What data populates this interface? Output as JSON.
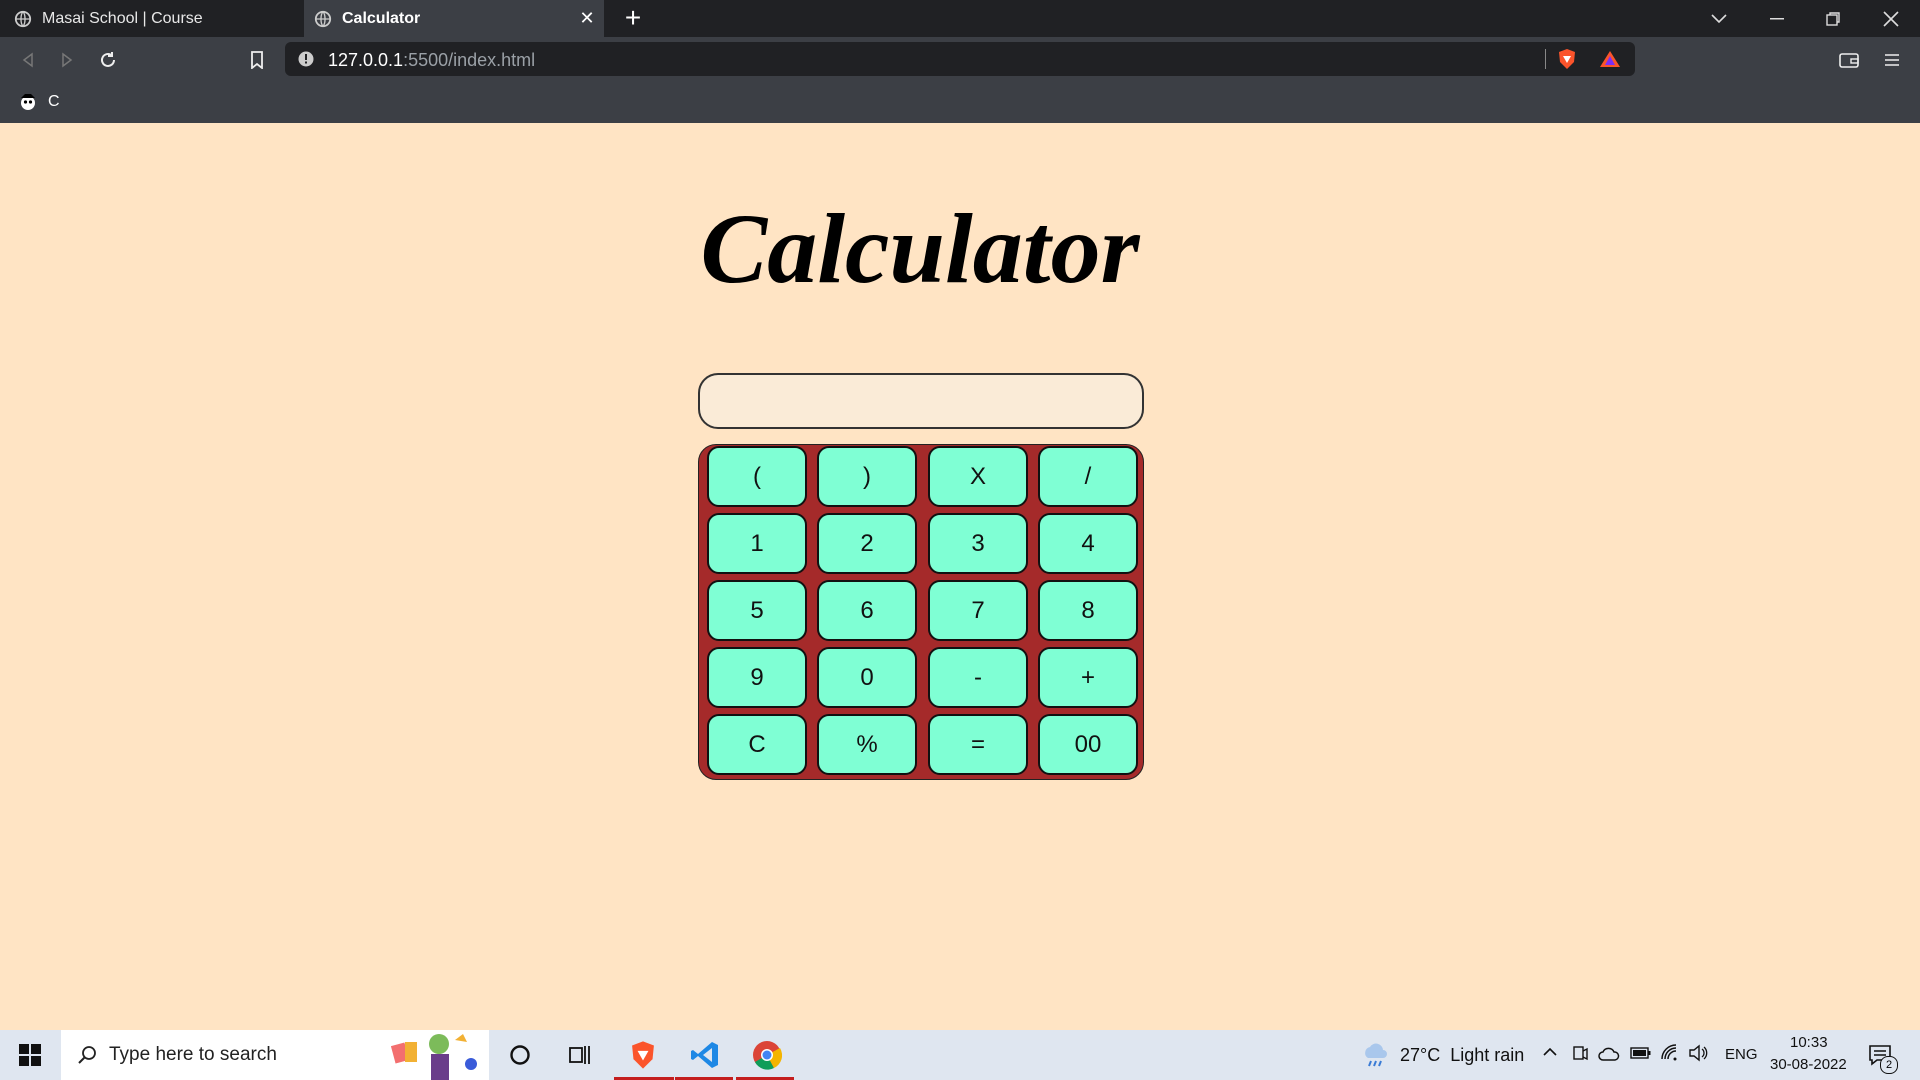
{
  "browser": {
    "tabs": [
      {
        "label": "Masai School | Course"
      },
      {
        "label": "Calculator"
      }
    ],
    "url_host": "127.0.0.1",
    "url_rest": ":5500/index.html",
    "bookmark_label": "C"
  },
  "page": {
    "title": "Calculator",
    "display_value": ""
  },
  "keypad": {
    "keys": [
      [
        "(",
        ")",
        "X",
        "/"
      ],
      [
        "1",
        "2",
        "3",
        "4"
      ],
      [
        "5",
        "6",
        "7",
        "8"
      ],
      [
        "9",
        "0",
        "-",
        "+"
      ],
      [
        "C",
        "%",
        "=",
        "00"
      ]
    ]
  },
  "taskbar": {
    "search_placeholder": "Type here to search",
    "weather": "27°C  Light rain",
    "language": "ENG",
    "time": "10:33",
    "date": "30-08-2022",
    "notification_count": "2"
  },
  "colors": {
    "page_bg": "#ffe4c4",
    "display_bg": "#faebd7",
    "pad_bg": "#a52a2a",
    "key_bg": "#7fffd4"
  }
}
